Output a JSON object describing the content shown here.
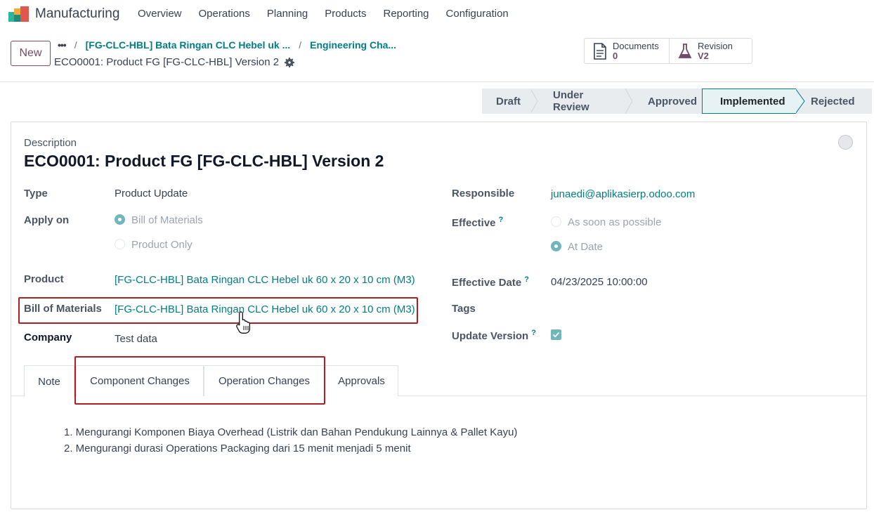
{
  "app": {
    "name": "Manufacturing"
  },
  "menu": [
    "Overview",
    "Operations",
    "Planning",
    "Products",
    "Reporting",
    "Configuration"
  ],
  "control": {
    "new_label": "New",
    "breadcrumb_more": "•••",
    "breadcrumb": [
      "[FG-CLC-HBL] Bata Ringan CLC Hebel uk ...",
      "Engineering Cha..."
    ],
    "current": "ECO0001: Product FG [FG-CLC-HBL] Version 2",
    "smart_buttons": [
      {
        "label": "Documents",
        "value": "0"
      },
      {
        "label": "Revision",
        "value": "V2"
      }
    ]
  },
  "stages": [
    "Draft",
    "Under Review",
    "Approved",
    "Implemented",
    "Rejected"
  ],
  "active_stage": "Implemented",
  "form": {
    "description_label": "Description",
    "title": "ECO0001: Product FG [FG-CLC-HBL] Version 2",
    "type_label": "Type",
    "type_value": "Product Update",
    "apply_on_label": "Apply on",
    "apply_on_options": [
      "Bill of Materials",
      "Product Only"
    ],
    "product_label": "Product",
    "product_value": "[FG-CLC-HBL] Bata Ringan CLC Hebel uk 60 x 20 x 10 cm (M3)",
    "bom_label": "Bill of Materials",
    "bom_value": "[FG-CLC-HBL] Bata Ringan CLC Hebel uk 60 x 20 x 10 cm (M3)",
    "company_label": "Company",
    "company_value": "Test data",
    "responsible_label": "Responsible",
    "responsible_value": "junaedi@aplikasierp.odoo.com",
    "effective_label": "Effective",
    "effective_help": "?",
    "effective_options": [
      "As soon as possible",
      "At Date"
    ],
    "effective_date_label": "Effective Date",
    "effective_date_help": "?",
    "effective_date_value": "04/23/2025 10:00:00",
    "tags_label": "Tags",
    "update_version_label": "Update Version",
    "update_version_help": "?"
  },
  "tabs": [
    "Note",
    "Component Changes",
    "Operation Changes",
    "Approvals"
  ],
  "note_lines": [
    "1. Mengurangi Komponen Biaya Overhead (Listrik dan Bahan Pendukung Lainnya & Pallet Kayu)",
    "2. Mengurangi durasi Operations Packaging dari 15 menit menjadi 5 menit"
  ],
  "colors": {
    "brand": "#714B67",
    "link": "#017e84",
    "highlight_box": "#b01e23"
  }
}
